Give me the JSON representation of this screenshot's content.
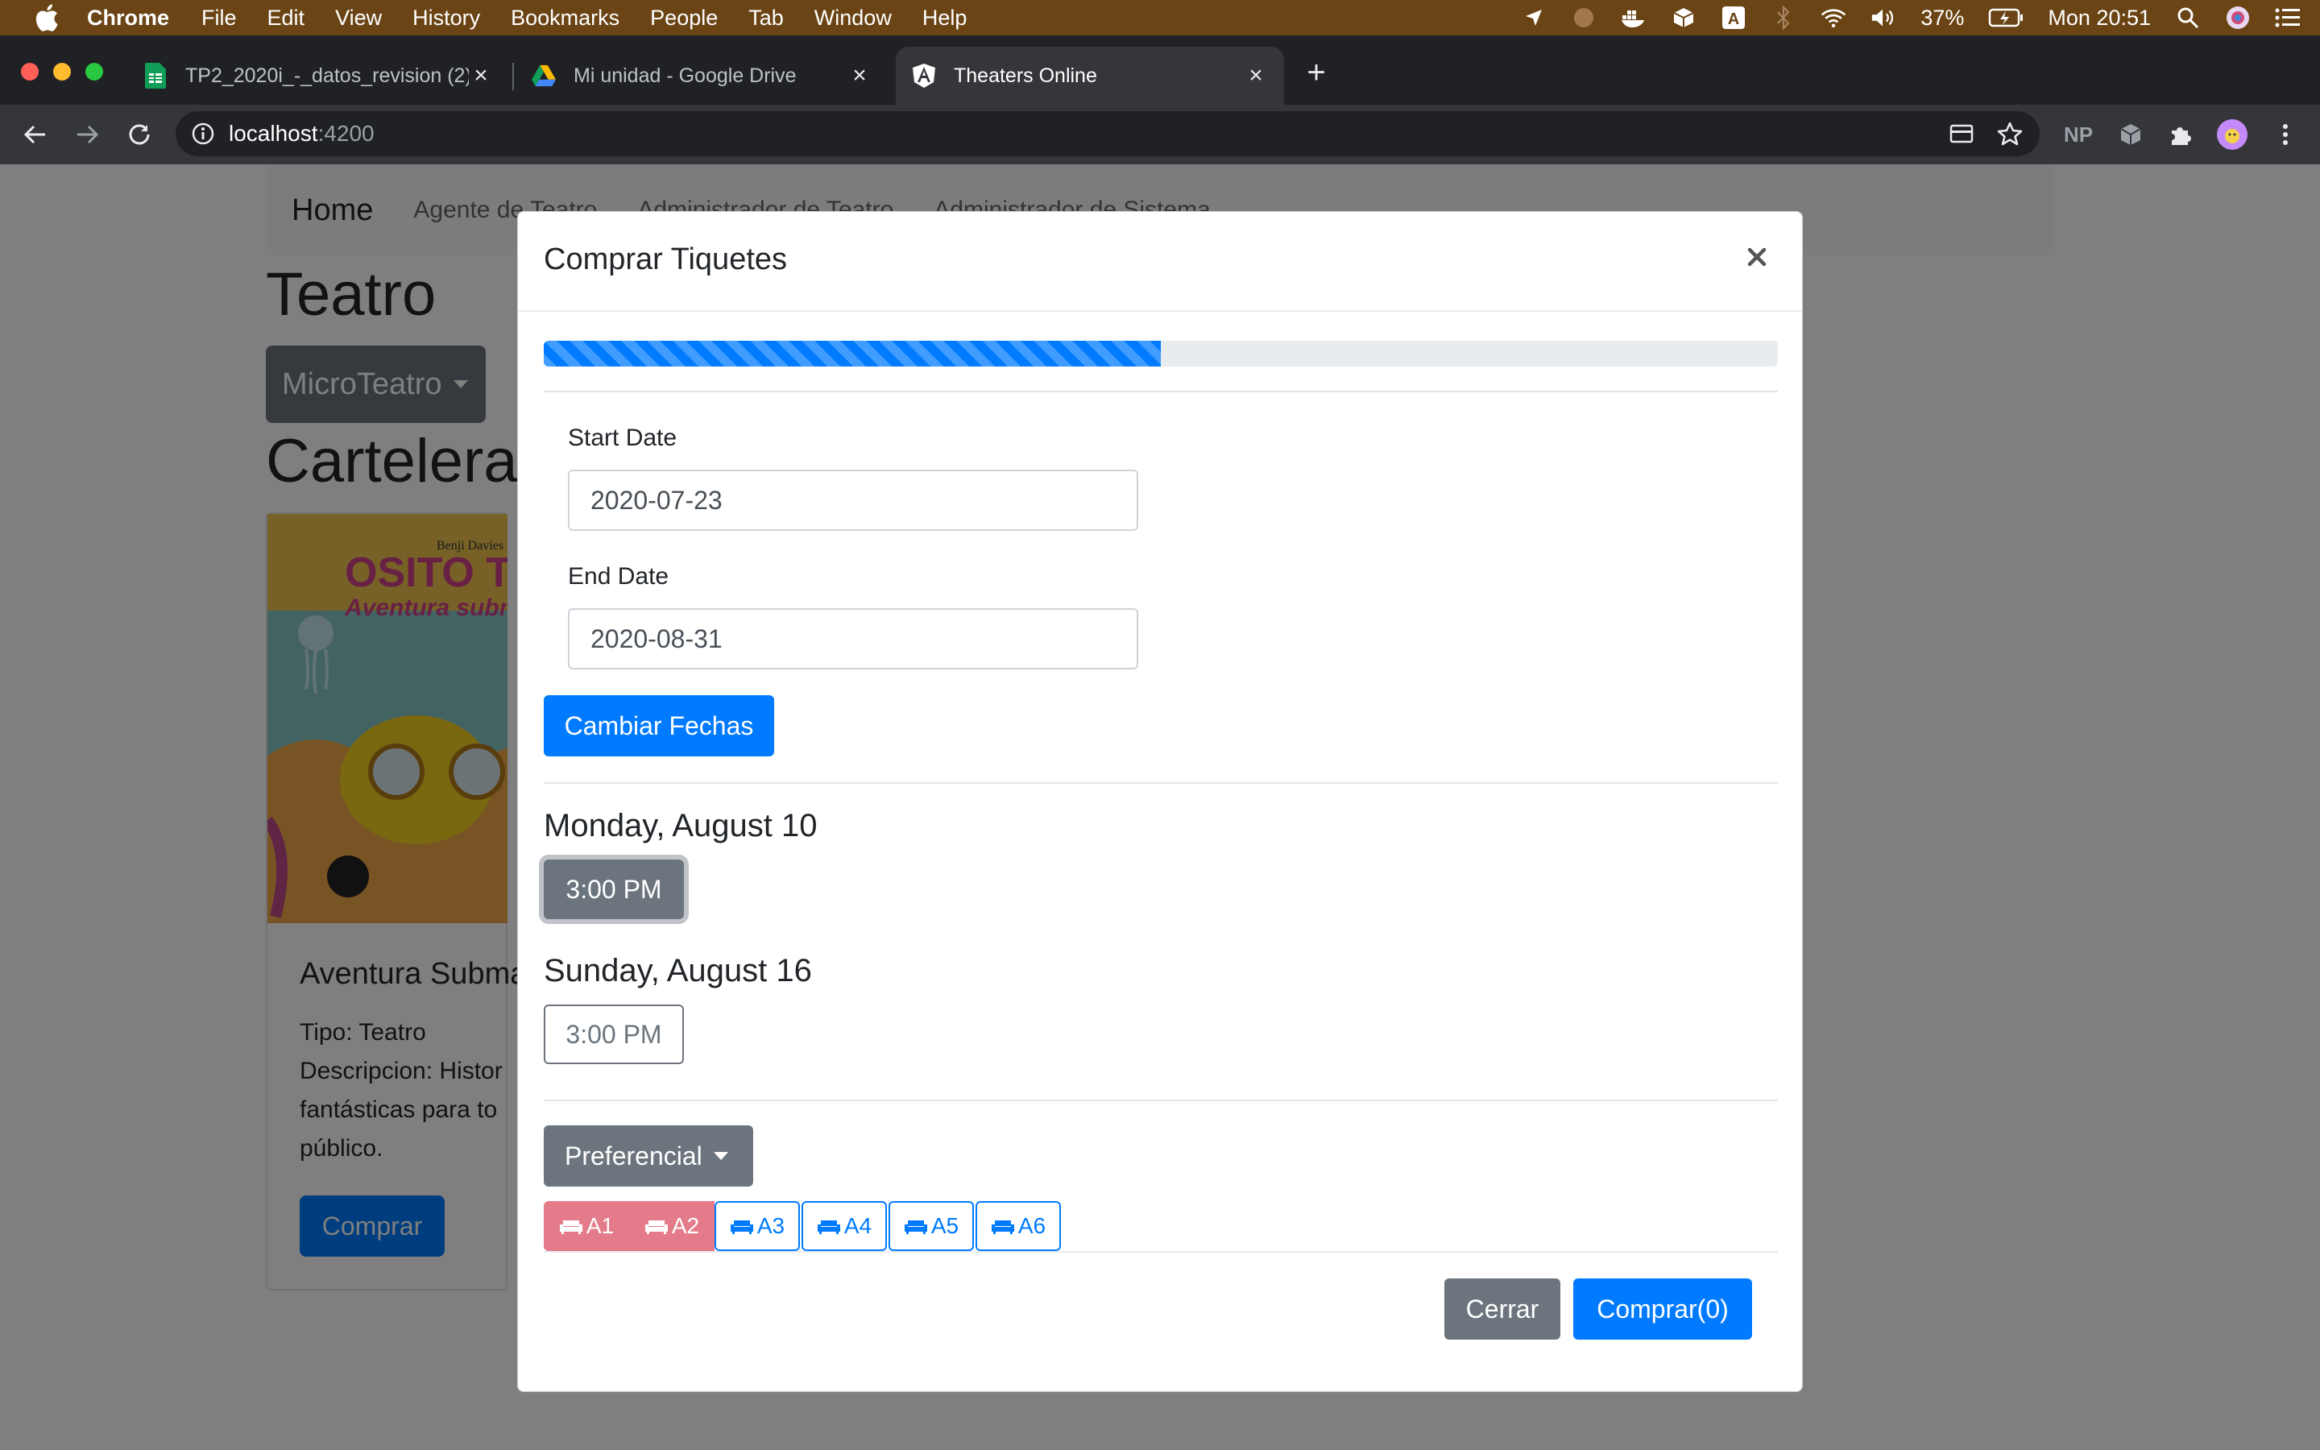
{
  "menubar": {
    "app_name": "Chrome",
    "items": [
      "File",
      "Edit",
      "View",
      "History",
      "Bookmarks",
      "People",
      "Tab",
      "Window",
      "Help"
    ],
    "battery": "37%",
    "clock": "Mon 20:51"
  },
  "browser": {
    "tabs": [
      {
        "title": "TP2_2020i_-_datos_revision (2)",
        "icon": "google-sheets-icon"
      },
      {
        "title": "Mi unidad - Google Drive",
        "icon": "google-drive-icon"
      },
      {
        "title": "Theaters Online",
        "icon": "angular-icon"
      }
    ],
    "url_host": "localhost",
    "url_port": ":4200",
    "extension_label": "NP"
  },
  "page": {
    "brand": "Home",
    "nav": [
      "Agente de Teatro",
      "Administrador de Teatro",
      "Administrador de Sistema"
    ],
    "heading": "Teatro",
    "theater_selected": "MicroTeatro",
    "section_heading": "Cartelera",
    "card": {
      "title": "Aventura Submarina",
      "poster_author": "Benji Davies",
      "poster_title_1": "OSITO T",
      "poster_title_2": "Aventura subm",
      "text_lines": [
        "Tipo: Teatro",
        "Descripcion: Histor",
        "fantásticas para to",
        "público."
      ],
      "buy_label": "Comprar"
    }
  },
  "modal": {
    "title": "Comprar Tiquetes",
    "close_symbol": "×",
    "progress_percent": 50,
    "start_label": "Start Date",
    "start_value": "2020-07-23",
    "end_label": "End Date",
    "end_value": "2020-08-31",
    "change_dates_label": "Cambiar Fechas",
    "days": [
      {
        "heading": "Monday, August 10",
        "times": [
          {
            "label": "3:00 PM",
            "active": true
          }
        ]
      },
      {
        "heading": "Sunday, August 16",
        "times": [
          {
            "label": "3:00 PM",
            "active": false
          }
        ]
      }
    ],
    "seat_type": "Preferencial",
    "seats": [
      {
        "label": "A1",
        "status": "taken"
      },
      {
        "label": "A2",
        "status": "taken"
      },
      {
        "label": "A3",
        "status": "available"
      },
      {
        "label": "A4",
        "status": "available"
      },
      {
        "label": "A5",
        "status": "available"
      },
      {
        "label": "A6",
        "status": "available"
      }
    ],
    "close_button": "Cerrar",
    "buy_button": "Comprar(0)"
  },
  "colors": {
    "primary": "#007bff",
    "secondary": "#6c757d",
    "seat_taken": "#e47b8a",
    "menubar": "#6a4414"
  }
}
